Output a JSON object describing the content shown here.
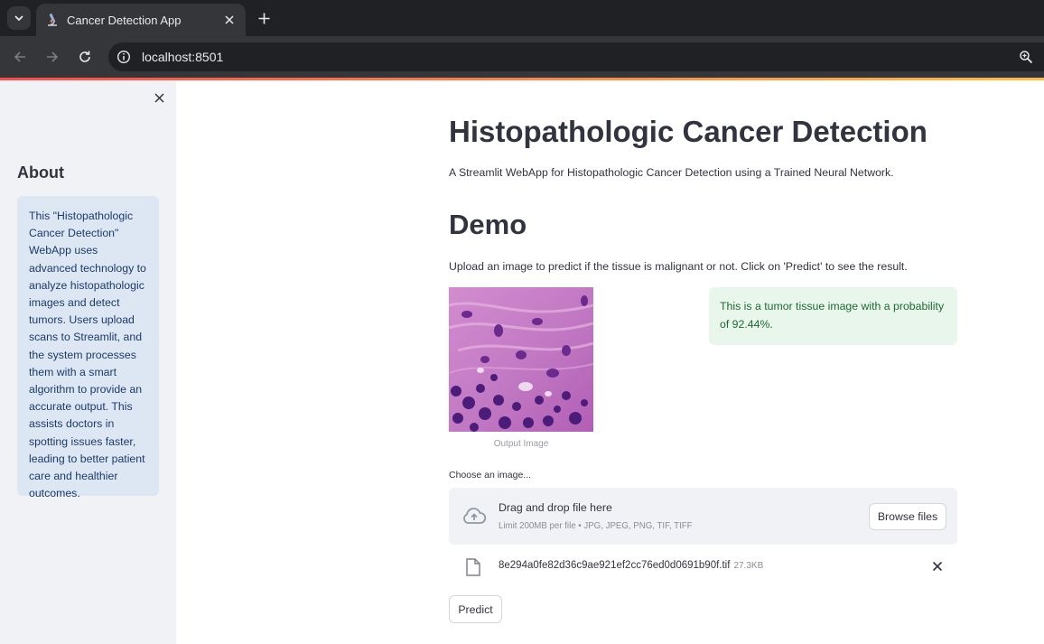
{
  "browser": {
    "tab_title": "Cancer Detection App",
    "url": "localhost:8501"
  },
  "sidebar": {
    "heading": "About",
    "about_text": "This \"Histopathologic Cancer Detection\" WebApp uses advanced technology to analyze histopathologic images and detect tumors. Users upload scans to Streamlit, and the system processes them with a smart algorithm to provide an accurate output. This assists doctors in spotting issues faster, leading to better patient care and healthier outcomes."
  },
  "main": {
    "title": "Histopathologic Cancer Detection",
    "subtitle": "A Streamlit WebApp for Histopathologic Cancer Detection using a Trained Neural Network.",
    "section_heading": "Demo",
    "instructions": "Upload an image to predict if the tissue is malignant or not. Click on 'Predict' to see the result.",
    "image_caption": "Output Image",
    "result_message": "This is a tumor tissue image with a probability of 92.44%.",
    "uploader": {
      "label": "Choose an image...",
      "drop_title": "Drag and drop file here",
      "limit_text": "Limit 200MB per file • JPG, JPEG, PNG, TIF, TIFF",
      "browse_label": "Browse files"
    },
    "uploaded_file": {
      "name": "8e294a0fe82d36c9ae921ef2cc76ed0d0691b90f.tif",
      "size": "27.3KB"
    },
    "predict_label": "Predict"
  },
  "colors": {
    "sidebar_bg": "#f0f2f6",
    "info_box_bg": "#dde7f4",
    "success_bg": "#e8f6ec",
    "success_text": "#1d6a35",
    "accent_gradient_start": "#ff4b4b",
    "accent_gradient_end": "#ffbd45"
  }
}
